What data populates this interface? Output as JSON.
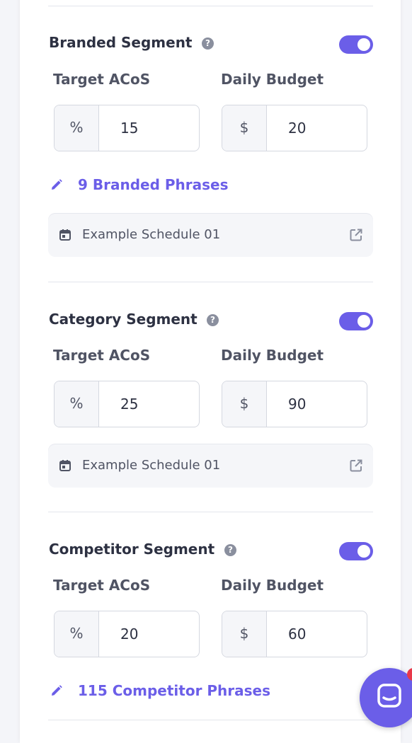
{
  "segments": [
    {
      "title": "Branded Segment",
      "enabled": true,
      "target_acos": {
        "label": "Target ACoS",
        "unit": "%",
        "value": "15"
      },
      "daily_budget": {
        "label": "Daily Budget",
        "unit": "$",
        "value": "20"
      },
      "phrases_link": "9 Branded Phrases",
      "schedule": "Example Schedule 01"
    },
    {
      "title": "Category Segment",
      "enabled": true,
      "target_acos": {
        "label": "Target ACoS",
        "unit": "%",
        "value": "25"
      },
      "daily_budget": {
        "label": "Daily Budget",
        "unit": "$",
        "value": "90"
      },
      "schedule": "Example Schedule 01"
    },
    {
      "title": "Competitor Segment",
      "enabled": true,
      "target_acos": {
        "label": "Target ACoS",
        "unit": "%",
        "value": "20"
      },
      "daily_budget": {
        "label": "Daily Budget",
        "unit": "$",
        "value": "60"
      },
      "phrases_link": "115 Competitor Phrases"
    }
  ],
  "icons": {
    "help": "question-circle-icon",
    "edit": "pencil-icon",
    "schedule": "calendar-icon",
    "open": "external-link-icon",
    "chat": "chat-icon"
  },
  "colors": {
    "accent": "#6b5ee8",
    "badge": "#e8394a"
  }
}
